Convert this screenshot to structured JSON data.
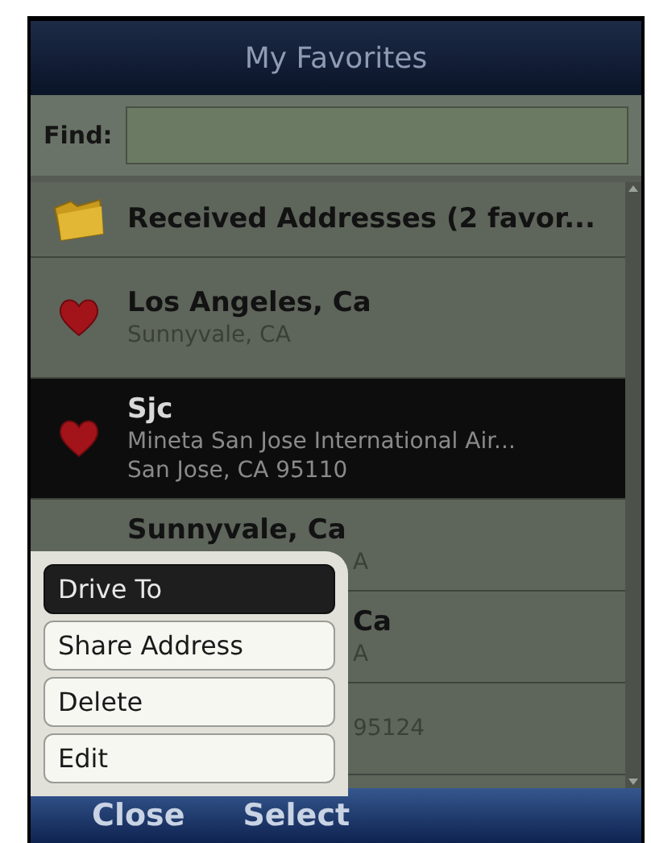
{
  "title": "My Favorites",
  "find": {
    "label": "Find:"
  },
  "items": [
    {
      "kind": "folder",
      "title": "Received Addresses (2 favor...",
      "selected": false
    },
    {
      "kind": "favorite",
      "title": "Los Angeles, Ca",
      "lines": [
        "Sunnyvale, CA"
      ],
      "selected": false
    },
    {
      "kind": "favorite",
      "title": "Sjc",
      "lines": [
        "Mineta San Jose International Air...",
        "San Jose, CA 95110"
      ],
      "selected": true
    },
    {
      "kind": "partial",
      "title": "Sunnyvale, Ca",
      "lines": [
        "A"
      ],
      "selected": false
    },
    {
      "kind": "partial",
      "title": "Ca",
      "lines": [
        "A"
      ],
      "selected": false
    },
    {
      "kind": "partial",
      "lines": [
        "95124"
      ],
      "selected": false
    }
  ],
  "menu": [
    {
      "label": "Drive To",
      "selected": true
    },
    {
      "label": "Share Address",
      "selected": false
    },
    {
      "label": "Delete",
      "selected": false
    },
    {
      "label": "Edit",
      "selected": false
    }
  ],
  "softkeys": [
    "Close",
    "Select"
  ]
}
